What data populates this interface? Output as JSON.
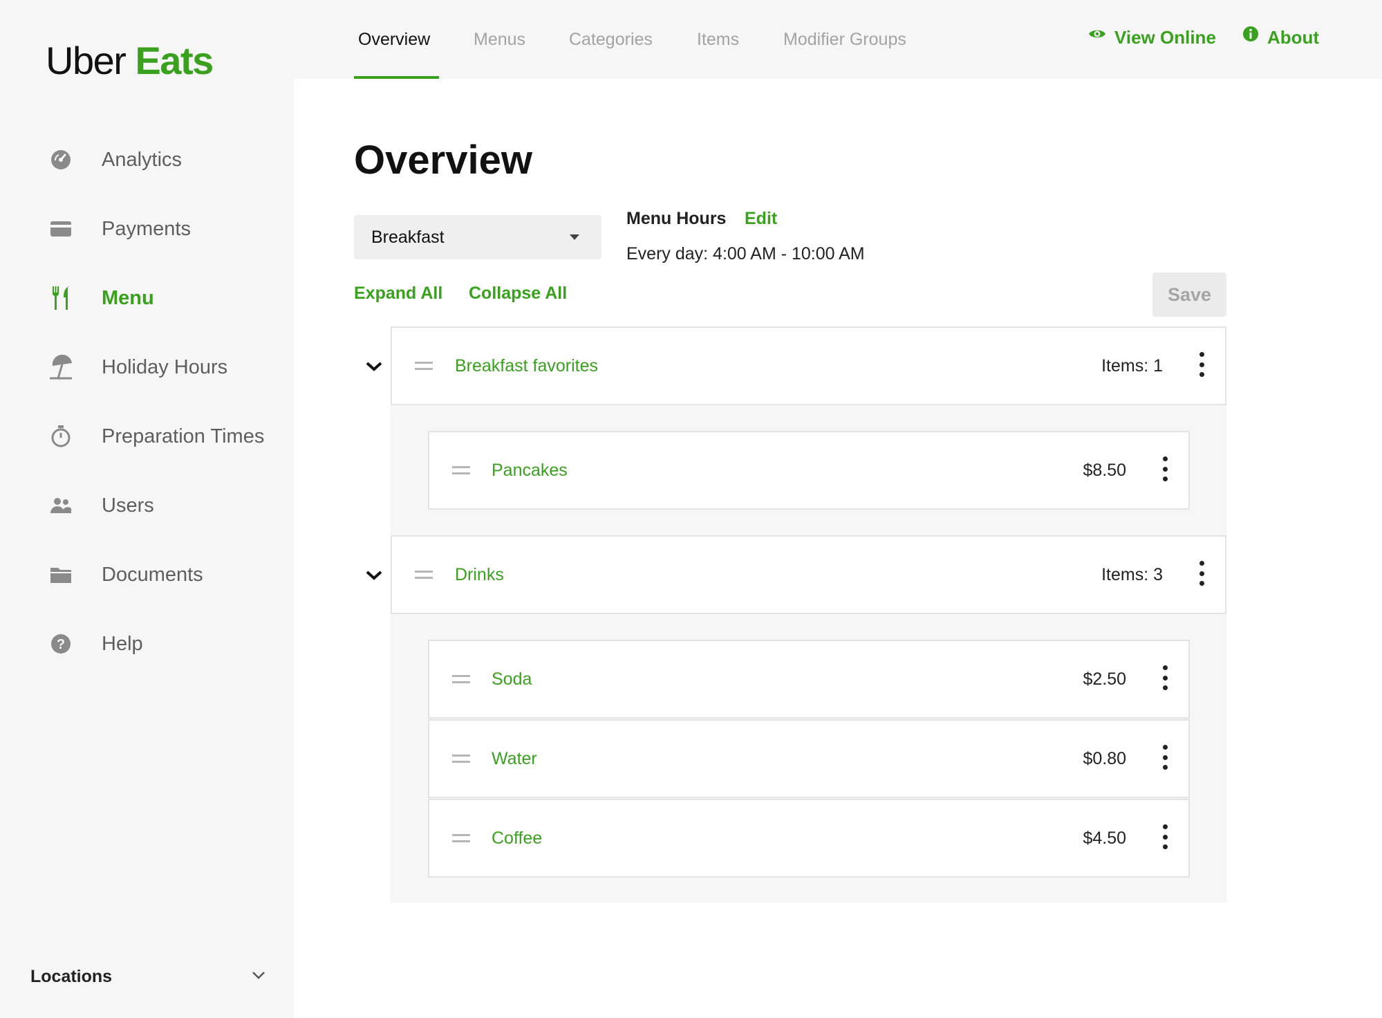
{
  "brand": {
    "word1": "Uber",
    "word2": "Eats",
    "accent_color": "#3aa11f"
  },
  "sidebar": {
    "items": [
      {
        "label": "Analytics",
        "icon": "gauge-icon",
        "active": false
      },
      {
        "label": "Payments",
        "icon": "credit-card-icon",
        "active": false
      },
      {
        "label": "Menu",
        "icon": "fork-knife-icon",
        "active": true
      },
      {
        "label": "Holiday Hours",
        "icon": "beach-umbrella-icon",
        "active": false
      },
      {
        "label": "Preparation Times",
        "icon": "stopwatch-icon",
        "active": false
      },
      {
        "label": "Users",
        "icon": "users-icon",
        "active": false
      },
      {
        "label": "Documents",
        "icon": "folder-icon",
        "active": false
      },
      {
        "label": "Help",
        "icon": "help-icon",
        "active": false
      }
    ],
    "locations_label": "Locations"
  },
  "topnav": {
    "tabs": [
      {
        "label": "Overview",
        "active": true
      },
      {
        "label": "Menus",
        "active": false
      },
      {
        "label": "Categories",
        "active": false
      },
      {
        "label": "Items",
        "active": false
      },
      {
        "label": "Modifier Groups",
        "active": false
      }
    ],
    "view_online": "View Online",
    "about": "About"
  },
  "main": {
    "title": "Overview",
    "menu_select": {
      "value": "Breakfast"
    },
    "menu_hours": {
      "label": "Menu Hours",
      "edit": "Edit",
      "value": "Every day: 4:00 AM - 10:00 AM"
    },
    "expand_all": "Expand All",
    "collapse_all": "Collapse All",
    "save": "Save",
    "categories": [
      {
        "name": "Breakfast favorites",
        "count_label": "Items: 1",
        "items": [
          {
            "name": "Pancakes",
            "price": "$8.50"
          }
        ]
      },
      {
        "name": "Drinks",
        "count_label": "Items: 3",
        "items": [
          {
            "name": "Soda",
            "price": "$2.50"
          },
          {
            "name": "Water",
            "price": "$0.80"
          },
          {
            "name": "Coffee",
            "price": "$4.50"
          }
        ]
      }
    ]
  }
}
